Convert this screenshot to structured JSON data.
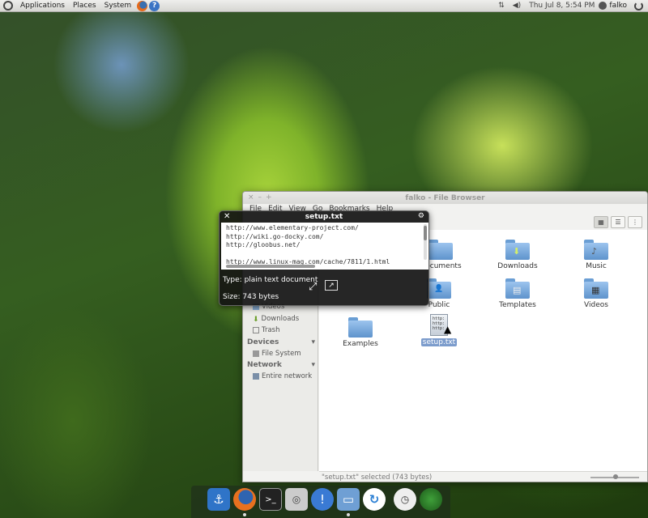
{
  "top_panel": {
    "menus": [
      "Applications",
      "Places",
      "System"
    ],
    "clock": "Thu Jul  8,  5:54 PM",
    "user": "falko",
    "network_glyph": "⇅",
    "volume_glyph": "◀)"
  },
  "file_browser": {
    "title": "falko - File Browser",
    "window_buttons": [
      "×",
      "–",
      "+"
    ],
    "menu": [
      "File",
      "Edit",
      "View",
      "Go",
      "Bookmarks",
      "Help"
    ],
    "sidebar": {
      "places_items": [
        "Videos",
        "Downloads",
        "Trash"
      ],
      "devices_header": "Devices",
      "devices_items": [
        "File System"
      ],
      "network_header": "Network",
      "network_items": [
        "Entire network"
      ]
    },
    "files": [
      {
        "label": "Documents",
        "kind": "folder",
        "glyph": ""
      },
      {
        "label": "Downloads",
        "kind": "folder",
        "glyph": "⬇"
      },
      {
        "label": "Music",
        "kind": "folder",
        "glyph": "♪"
      },
      {
        "label": "Public",
        "kind": "folder",
        "glyph": "👤"
      },
      {
        "label": "Templates",
        "kind": "folder",
        "glyph": "▤"
      },
      {
        "label": "Videos",
        "kind": "folder",
        "glyph": "▦"
      },
      {
        "label": "Examples",
        "kind": "folder",
        "glyph": ""
      },
      {
        "label": "setup.txt",
        "kind": "text",
        "glyph": ""
      }
    ],
    "status": "\"setup.txt\" selected (743 bytes)"
  },
  "preview": {
    "title": "setup.txt",
    "lines": [
      "http://www.elementary-project.com/",
      "http://wiki.go-docky.com/",
      "http://gloobus.net/",
      "",
      "http://www.linux-mag.com/cache/7811/1.html"
    ],
    "type": "Type: plain text document",
    "size": "Size: 743 bytes"
  },
  "txt_icon_text": "http:\nhttp:\nhttp:",
  "dock_items": [
    "anchor",
    "firefox",
    "terminal",
    "disk",
    "notification",
    "files",
    "refresh",
    "clock",
    "globe"
  ]
}
